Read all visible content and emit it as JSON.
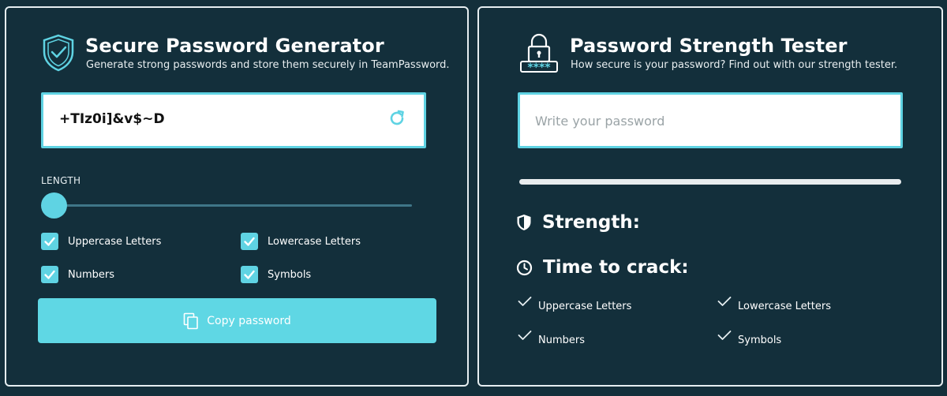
{
  "generator": {
    "title": "Secure Password Generator",
    "subtitle": "Generate strong passwords and store them securely in TeamPassword.",
    "password": "+TIz0i]&v$~D",
    "length_label": "LENGTH",
    "length_fraction": 0.0,
    "options": {
      "uppercase": "Uppercase Letters",
      "lowercase": "Lowercase Letters",
      "numbers": "Numbers",
      "symbols": "Symbols"
    },
    "copy_label": "Copy password"
  },
  "tester": {
    "title": "Password Strength Tester",
    "subtitle": "How secure is your password? Find out with our strength tester.",
    "input_placeholder": "Write your password",
    "strength_label": "Strength:",
    "time_label": "Time to crack:",
    "lock_stars": "****",
    "requirements": {
      "uppercase": "Uppercase Letters",
      "lowercase": "Lowercase Letters",
      "numbers": "Numbers",
      "symbols": "Symbols"
    }
  },
  "colors": {
    "background": "#132f3b",
    "accent": "#5fd3e3",
    "border": "#e6eef1"
  },
  "icons": {
    "generator": "shield-check-icon",
    "tester": "padlock-password-icon",
    "refresh": "refresh-icon",
    "copy": "copy-icon",
    "strength": "shield-icon",
    "time": "clock-icon",
    "requirement": "check-icon"
  }
}
